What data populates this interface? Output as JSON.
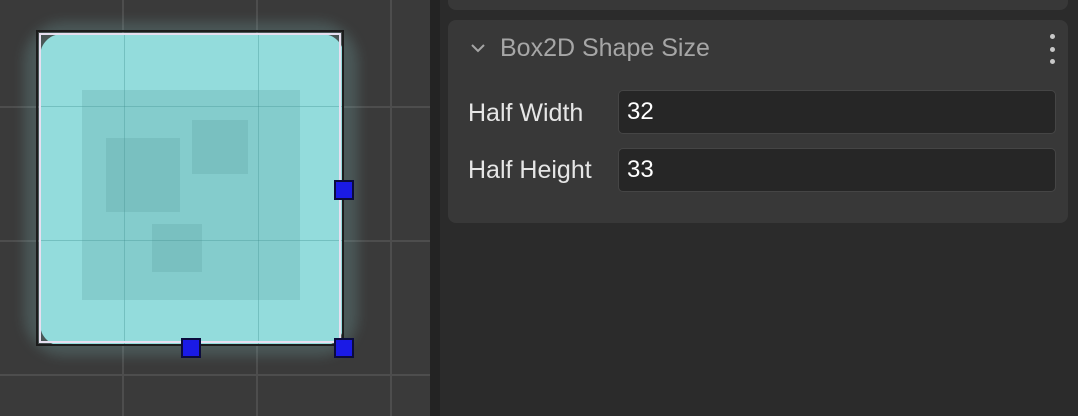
{
  "inspector": {
    "section": {
      "title": "Box2D Shape Size",
      "collapse_icon": "chevron-down-icon",
      "menu_icon": "more-vertical-icon",
      "fields": [
        {
          "label": "Half Width",
          "value": "32"
        },
        {
          "label": "Half Height",
          "value": "33"
        }
      ]
    }
  },
  "viewport": {
    "handle_color": "#1a1ae6",
    "sprite_color": "#93dcdc"
  }
}
